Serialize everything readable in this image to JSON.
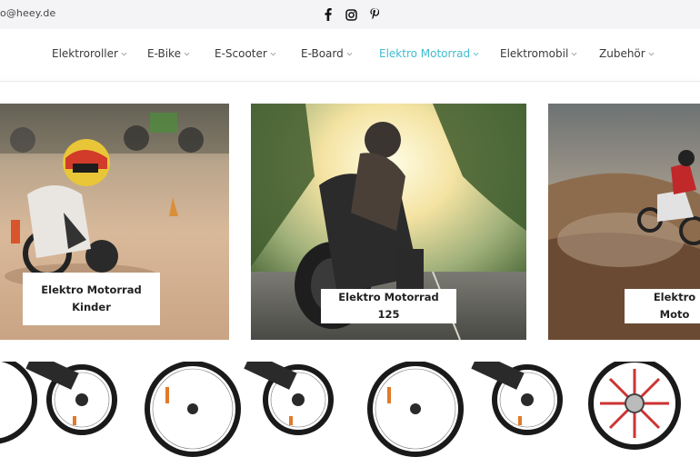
{
  "topbar": {
    "email": "o@heey.de",
    "social": [
      "facebook-icon",
      "instagram-icon",
      "pinterest-icon"
    ]
  },
  "nav": {
    "items": [
      {
        "label": "Elektroroller",
        "active": false
      },
      {
        "label": "E-Bike",
        "active": false
      },
      {
        "label": "E-Scooter",
        "active": false
      },
      {
        "label": "E-Board",
        "active": false
      },
      {
        "label": "Elektro Motorrad",
        "active": true
      },
      {
        "label": "Elektromobil",
        "active": false
      },
      {
        "label": "Zubehör",
        "active": false
      }
    ],
    "active_color": "#3fbccf"
  },
  "dropdown": {
    "cards": [
      {
        "label": "Elektro Motorrad Kinder"
      },
      {
        "label": "Elektro Motorrad 125"
      },
      {
        "label": "Elektro Moto"
      }
    ]
  }
}
